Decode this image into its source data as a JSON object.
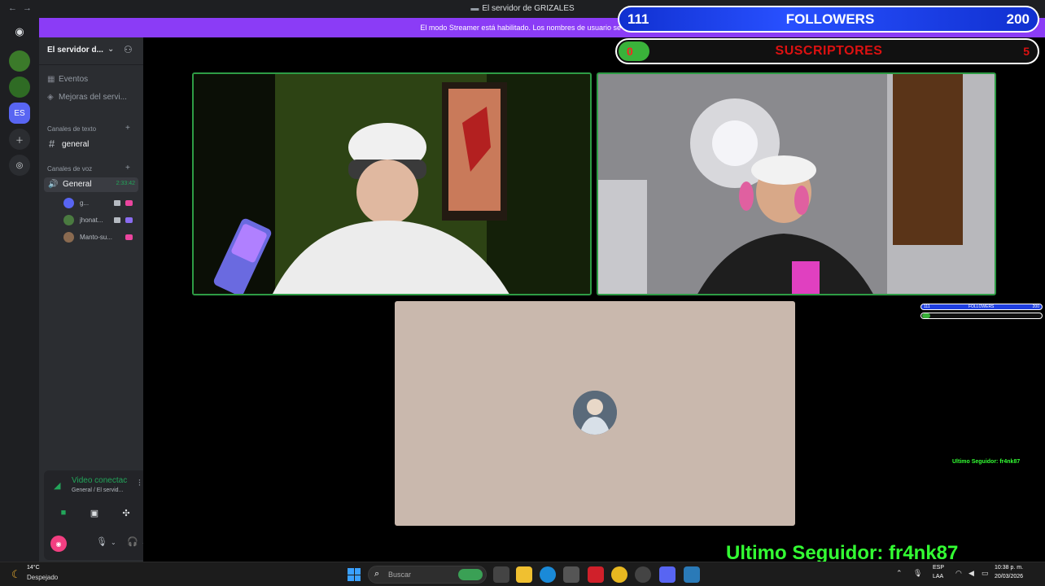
{
  "window": {
    "title": "El servidor de GRIZALES",
    "banner": "El modo Streamer está habilitado. Los nombres de usuario se han trunca..."
  },
  "server": {
    "name": "El servidor d...",
    "menu": [
      {
        "icon": "calendar-icon",
        "label": "Eventos"
      },
      {
        "icon": "boost-icon",
        "label": "Mejoras del servi..."
      }
    ],
    "text_category": "Canales de texto",
    "text_channel": "general",
    "voice_category": "Canales de voz",
    "voice_channel": "General",
    "voice_timer": "2:33:42",
    "voice_users": [
      {
        "name": "g...",
        "live_color": "#eb459e"
      },
      {
        "name": "jhonat...",
        "live_color": "#8a6cf0"
      },
      {
        "name": "Manto-su...",
        "live_color": "#eb459e"
      }
    ]
  },
  "voice_panel": {
    "status": "Video conectac",
    "location": "General / El servid..."
  },
  "overlay": {
    "followers_current": "111",
    "followers_title": "FOLLOWERS",
    "followers_goal": "200",
    "followers_progress": 0.555,
    "subs_current": "0",
    "subs_title": "SUSCRIPTORES",
    "subs_goal": "5",
    "mini_followers_current": "111",
    "mini_followers_title": "FOLLOWERS",
    "mini_followers_goal": "200",
    "last_follower_small": "Ultimo Seguidor: fr4nk87",
    "last_follower_big": "Ultimo Seguidor: fr4nk87"
  },
  "taskbar": {
    "temperature": "14°C",
    "weather": "Despejado",
    "search_placeholder": "Buscar",
    "lang_top": "ESP",
    "lang_bottom": "LAA",
    "time": "10:38 p. m.",
    "date": "20/03/2026"
  },
  "colors": {
    "accent_green": "#23a55a",
    "banner_purple": "#8b3cf6",
    "overlay_green": "#33ff33"
  }
}
